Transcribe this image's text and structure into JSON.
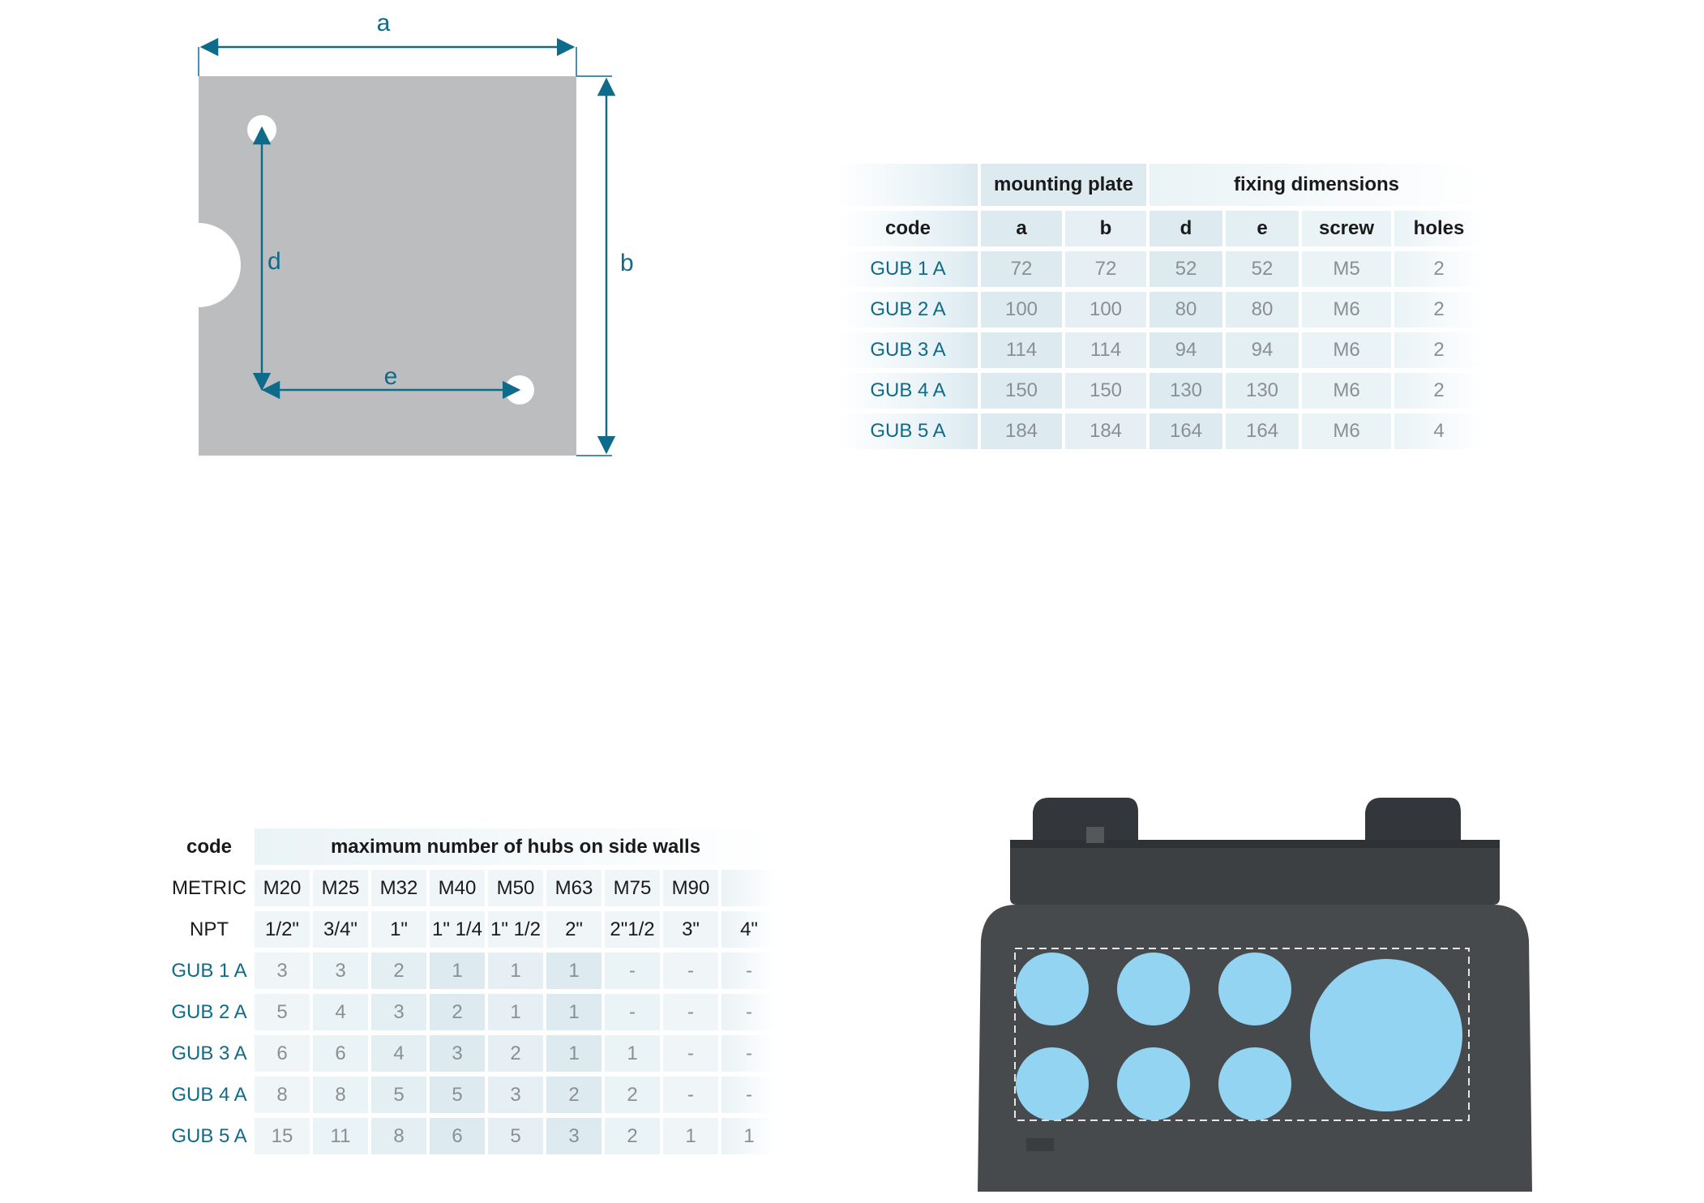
{
  "drawing": {
    "labels": {
      "a": "a",
      "b": "b",
      "d": "d",
      "e": "e"
    },
    "colors": {
      "plate": "#bcbdbf",
      "dimension": "#0e6b8a",
      "hole": "#ffffff"
    }
  },
  "fixing_table": {
    "group_headers": {
      "mounting_plate": "mounting plate",
      "fixing_dimensions": "fixing dimensions"
    },
    "columns": [
      "code",
      "a",
      "b",
      "d",
      "e",
      "screw",
      "holes"
    ],
    "rows": [
      [
        "GUB 1 A",
        "72",
        "72",
        "52",
        "52",
        "M5",
        "2"
      ],
      [
        "GUB 2 A",
        "100",
        "100",
        "80",
        "80",
        "M6",
        "2"
      ],
      [
        "GUB 3 A",
        "114",
        "114",
        "94",
        "94",
        "M6",
        "2"
      ],
      [
        "GUB 4 A",
        "150",
        "150",
        "130",
        "130",
        "M6",
        "2"
      ],
      [
        "GUB 5 A",
        "184",
        "184",
        "164",
        "164",
        "M6",
        "4"
      ]
    ]
  },
  "hubs_table": {
    "code_header": "code",
    "title": "maximum number of hubs  on side walls",
    "metric_label": "METRIC",
    "metric_sizes": [
      "M20",
      "M25",
      "M32",
      "M40",
      "M50",
      "M63",
      "M75",
      "M90",
      ""
    ],
    "npt_label": "NPT",
    "npt_sizes": [
      "1/2\"",
      "3/4\"",
      "1\"",
      "1\" 1/4",
      "1\" 1/2",
      "2\"",
      "2\"1/2",
      "3\"",
      "4\""
    ],
    "rows": [
      [
        "GUB 1 A",
        "3",
        "3",
        "2",
        "1",
        "1",
        "1",
        "-",
        "-",
        "-"
      ],
      [
        "GUB 2 A",
        "5",
        "4",
        "3",
        "2",
        "1",
        "1",
        "-",
        "-",
        "-"
      ],
      [
        "GUB 3 A",
        "6",
        "6",
        "4",
        "3",
        "2",
        "1",
        "1",
        "-",
        "-"
      ],
      [
        "GUB 4 A",
        "8",
        "8",
        "5",
        "5",
        "3",
        "2",
        "2",
        "-",
        "-"
      ],
      [
        "GUB 5 A",
        "15",
        "11",
        "8",
        "6",
        "5",
        "3",
        "2",
        "1",
        "1"
      ]
    ]
  },
  "enclosure": {
    "colors": {
      "body": "#474a4d",
      "top": "#3b3e41",
      "hub": "#93d4f2",
      "outline": "#e6e6e6"
    }
  }
}
